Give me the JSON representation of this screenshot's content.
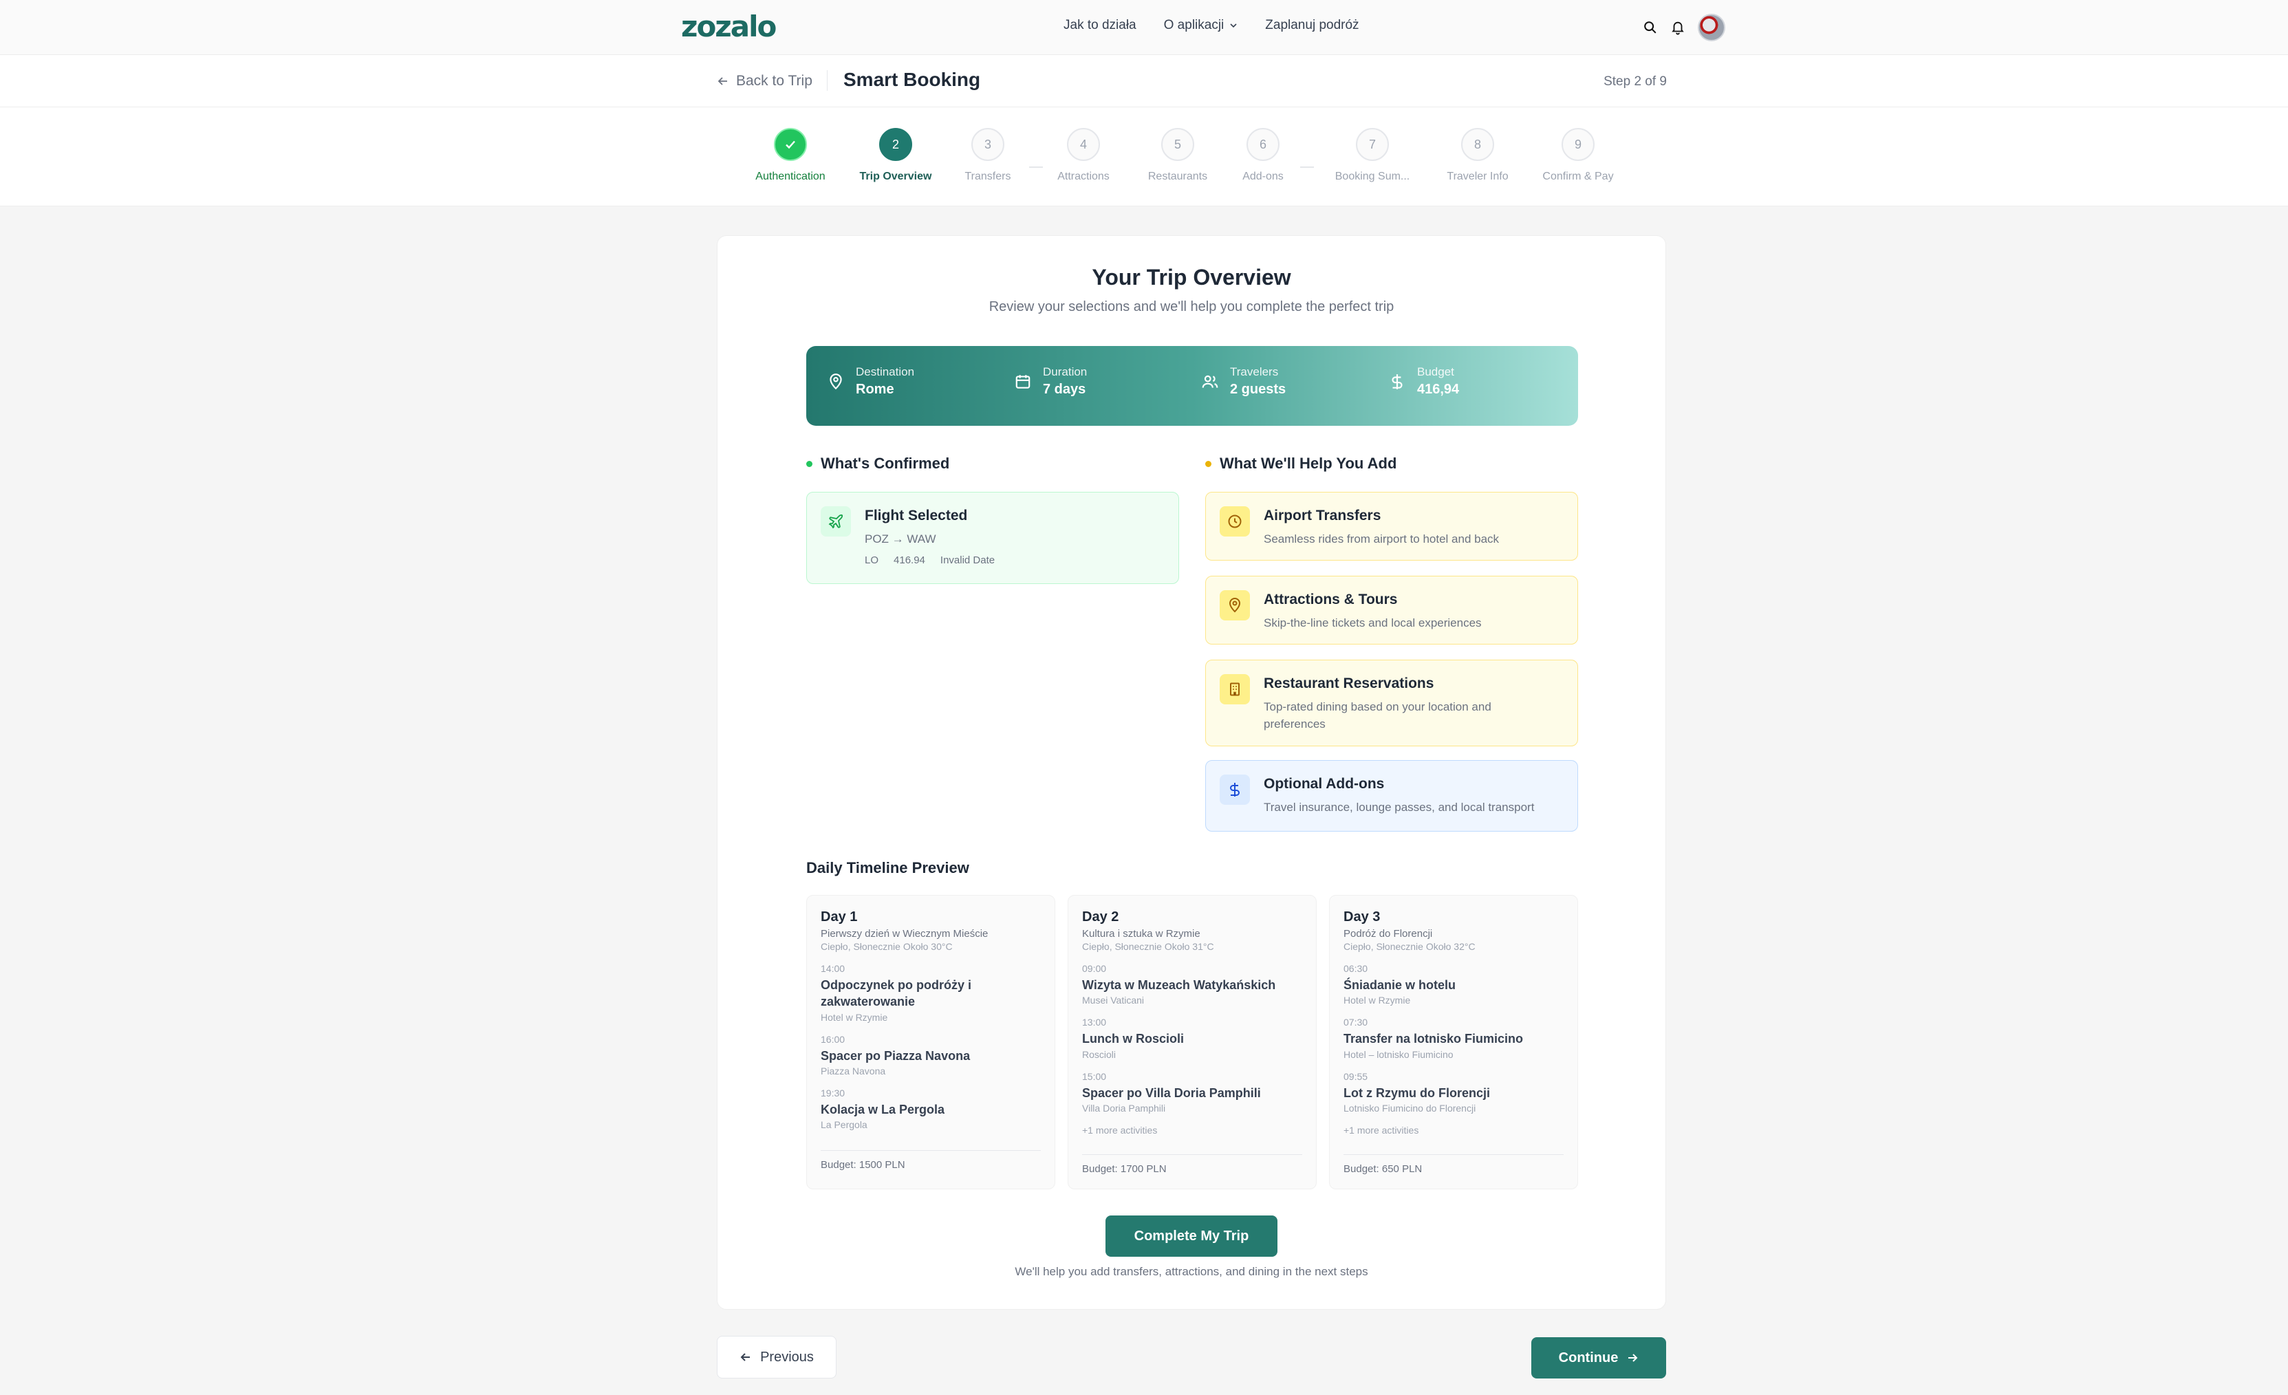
{
  "nav": {
    "logo": "zozalo",
    "links": [
      "Jak to działa",
      "O aplikacji",
      "Zaplanuj podróż"
    ]
  },
  "header": {
    "back_label": "Back to Trip",
    "title": "Smart Booking",
    "step_indicator": "Step 2 of 9"
  },
  "steps": [
    {
      "num": "1",
      "label": "Authentication",
      "state": "done"
    },
    {
      "num": "2",
      "label": "Trip Overview",
      "state": "active"
    },
    {
      "num": "3",
      "label": "Transfers",
      "state": "pending"
    },
    {
      "num": "4",
      "label": "Attractions",
      "state": "pending"
    },
    {
      "num": "5",
      "label": "Restaurants",
      "state": "pending"
    },
    {
      "num": "6",
      "label": "Add-ons",
      "state": "pending"
    },
    {
      "num": "7",
      "label": "Booking Sum...",
      "state": "pending"
    },
    {
      "num": "8",
      "label": "Traveler Info",
      "state": "pending"
    },
    {
      "num": "9",
      "label": "Confirm & Pay",
      "state": "pending"
    }
  ],
  "overview": {
    "title": "Your Trip Overview",
    "subtitle": "Review your selections and we'll help you complete the perfect trip",
    "summary": [
      {
        "label": "Destination",
        "value": "Rome",
        "icon": "map-pin-icon"
      },
      {
        "label": "Duration",
        "value": "7 days",
        "icon": "calendar-icon"
      },
      {
        "label": "Travelers",
        "value": "2 guests",
        "icon": "users-icon"
      },
      {
        "label": "Budget",
        "value": "416,94",
        "icon": "dollar-icon"
      }
    ]
  },
  "confirmed": {
    "heading": "What's Confirmed",
    "flight": {
      "title": "Flight Selected",
      "route": "POZ → WAW",
      "airline": "LO",
      "price": "416.94",
      "date": "Invalid Date"
    }
  },
  "help": {
    "heading": "What We'll Help You Add",
    "items": [
      {
        "title": "Airport Transfers",
        "desc": "Seamless rides from airport to hotel and back",
        "icon": "clock-icon"
      },
      {
        "title": "Attractions & Tours",
        "desc": "Skip-the-line tickets and local experiences",
        "icon": "map-pin-icon"
      },
      {
        "title": "Restaurant Reservations",
        "desc": "Top-rated dining based on your location and preferences",
        "icon": "building-icon"
      },
      {
        "title": "Optional Add-ons",
        "desc": "Travel insurance, lounge passes, and local transport",
        "icon": "dollar-icon"
      }
    ]
  },
  "timeline": {
    "heading": "Daily Timeline Preview",
    "days": [
      {
        "name": "Day 1",
        "theme": "Pierwszy dzień w Wiecznym Mieście",
        "weather": "Ciepło, Słonecznie Około 30°C",
        "activities": [
          {
            "time": "14:00",
            "name": "Odpoczynek po podróży i zakwaterowanie",
            "loc": "Hotel w Rzymie"
          },
          {
            "time": "16:00",
            "name": "Spacer po Piazza Navona",
            "loc": "Piazza Navona"
          },
          {
            "time": "19:30",
            "name": "Kolacja w La Pergola",
            "loc": "La Pergola"
          }
        ],
        "more": "",
        "budget": "Budget: 1500 PLN"
      },
      {
        "name": "Day 2",
        "theme": "Kultura i sztuka w Rzymie",
        "weather": "Ciepło, Słonecznie Około 31°C",
        "activities": [
          {
            "time": "09:00",
            "name": "Wizyta w Muzeach Watykańskich",
            "loc": "Musei Vaticani"
          },
          {
            "time": "13:00",
            "name": "Lunch w Roscioli",
            "loc": "Roscioli"
          },
          {
            "time": "15:00",
            "name": "Spacer po Villa Doria Pamphili",
            "loc": "Villa Doria Pamphili"
          }
        ],
        "more": "+1 more activities",
        "budget": "Budget: 1700 PLN"
      },
      {
        "name": "Day 3",
        "theme": "Podróż do Florencji",
        "weather": "Ciepło, Słonecznie Około 32°C",
        "activities": [
          {
            "time": "06:30",
            "name": "Śniadanie w hotelu",
            "loc": "Hotel w Rzymie"
          },
          {
            "time": "07:30",
            "name": "Transfer na lotnisko Fiumicino",
            "loc": "Hotel – lotnisko Fiumicino"
          },
          {
            "time": "09:55",
            "name": "Lot z Rzymu do Florencji",
            "loc": "Lotnisko Fiumicino do Florencji"
          }
        ],
        "more": "+1 more activities",
        "budget": "Budget: 650 PLN"
      }
    ]
  },
  "cta": {
    "label": "Complete My Trip",
    "note": "We'll help you add transfers, attractions, and dining in the next steps"
  },
  "footer": {
    "previous": "Previous",
    "continue": "Continue"
  },
  "colors": {
    "primary": "#257a6f",
    "success": "#22c55e",
    "warning": "#eab308"
  }
}
